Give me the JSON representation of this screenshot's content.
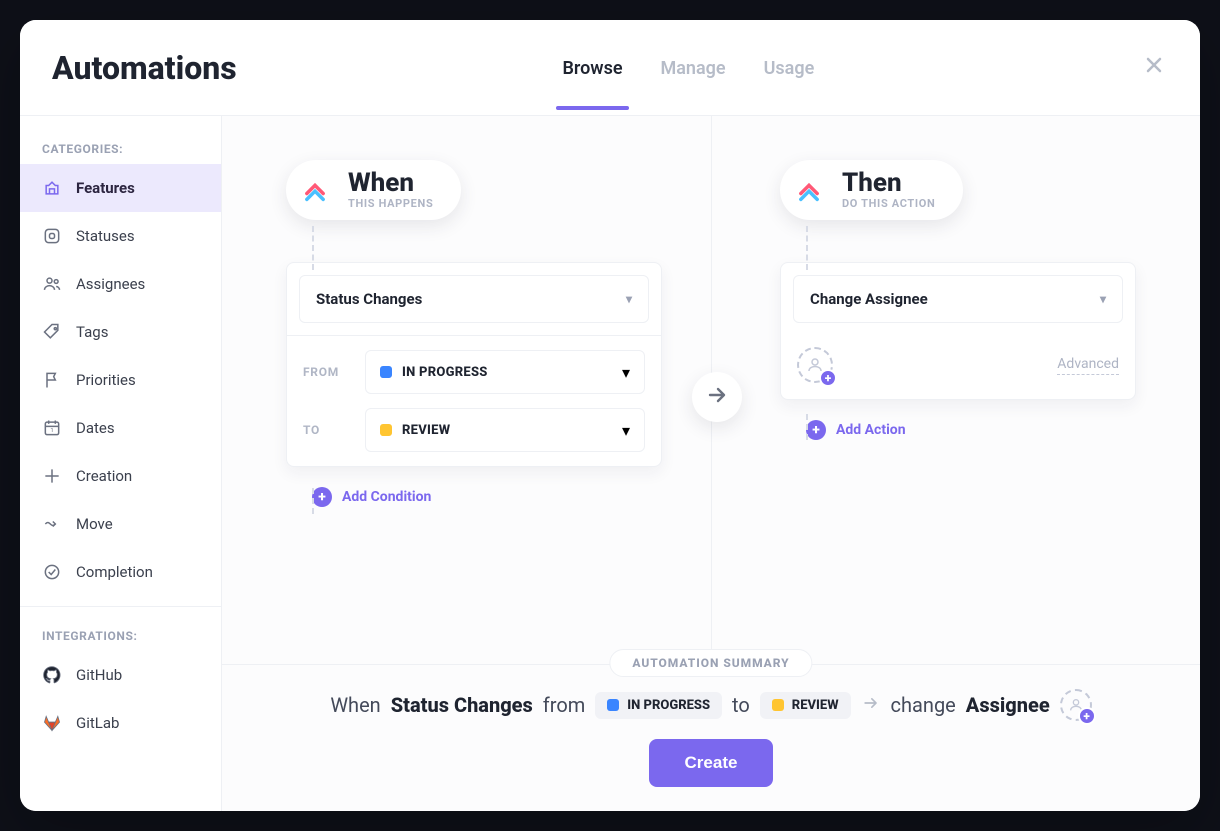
{
  "title": "Automations",
  "tabs": {
    "browse": "Browse",
    "manage": "Manage",
    "usage": "Usage"
  },
  "sidebar": {
    "heading_categories": "CATEGORIES:",
    "heading_integrations": "INTEGRATIONS:",
    "items": [
      {
        "label": "Features"
      },
      {
        "label": "Statuses"
      },
      {
        "label": "Assignees"
      },
      {
        "label": "Tags"
      },
      {
        "label": "Priorities"
      },
      {
        "label": "Dates"
      },
      {
        "label": "Creation"
      },
      {
        "label": "Move"
      },
      {
        "label": "Completion"
      }
    ],
    "integrations": [
      {
        "label": "GitHub"
      },
      {
        "label": "GitLab"
      }
    ]
  },
  "when": {
    "title": "When",
    "subtitle": "THIS HAPPENS",
    "trigger": "Status Changes",
    "from_label": "FROM",
    "to_label": "TO",
    "from_status": "IN PROGRESS",
    "to_status": "REVIEW",
    "add_condition": "Add Condition"
  },
  "then": {
    "title": "Then",
    "subtitle": "DO THIS ACTION",
    "action": "Change Assignee",
    "advanced": "Advanced",
    "add_action": "Add Action"
  },
  "summary": {
    "heading": "AUTOMATION SUMMARY",
    "when": "When",
    "trigger": "Status Changes",
    "from": "from",
    "to": "to",
    "from_status": "IN PROGRESS",
    "to_status": "REVIEW",
    "change": "change",
    "assignee": "Assignee",
    "create": "Create"
  },
  "colors": {
    "accent": "#7b68ee",
    "status_in_progress": "#3a85ff",
    "status_review": "#ffc531"
  }
}
